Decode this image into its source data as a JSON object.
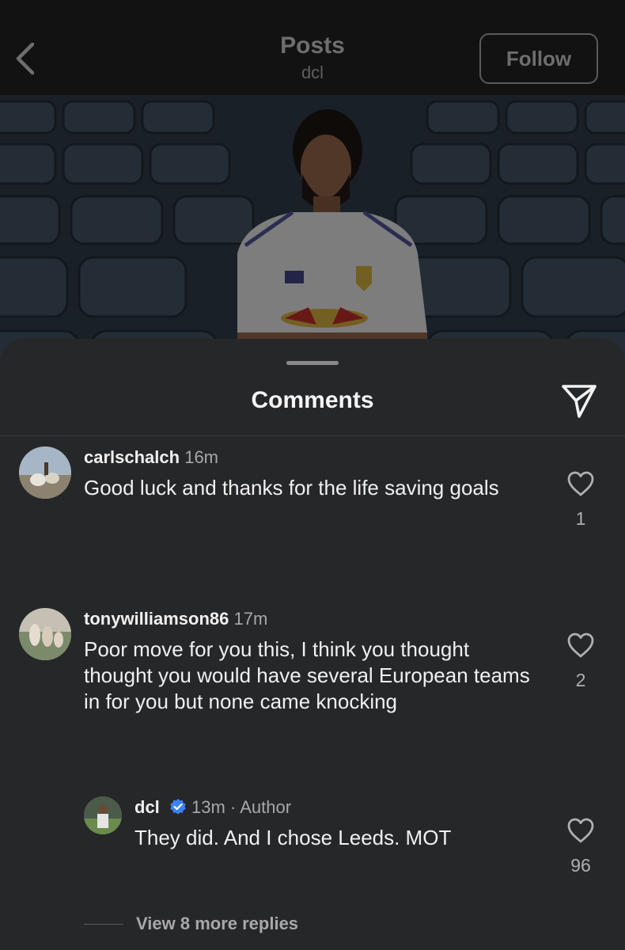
{
  "header": {
    "title": "Posts",
    "subtitle": "dcl",
    "follow_label": "Follow"
  },
  "comments_sheet": {
    "title": "Comments",
    "comments": [
      {
        "username": "carlschalch",
        "time": "16m",
        "text": "Good luck and thanks for the life saving goals",
        "likes": "1"
      },
      {
        "username": "tonywilliamson86",
        "time": "17m",
        "text": "Poor move for you this, I think you thought thought you would have several European teams in for you but none came knocking",
        "likes": "2"
      }
    ],
    "reply": {
      "username": "dcl",
      "time": "13m",
      "separator": "·",
      "role": "Author",
      "text": "They did. And I chose Leeds. MOT",
      "likes": "96"
    },
    "more_replies_label": "View 8 more replies"
  },
  "icons": {
    "back": "chevron-left-icon",
    "share": "send-icon",
    "like": "heart-icon",
    "verified": "verified-badge-icon"
  },
  "colors": {
    "sheet_bg": "#262729",
    "verified_blue": "#3b82f6"
  }
}
